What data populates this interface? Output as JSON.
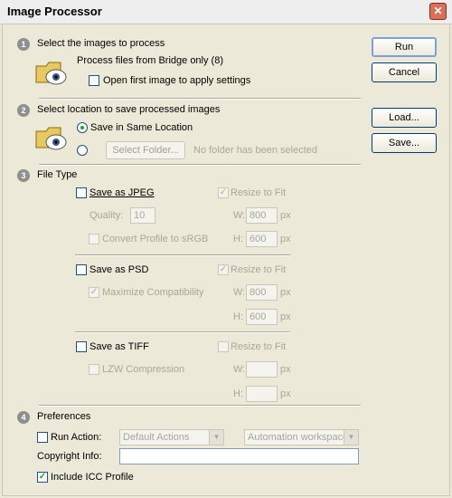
{
  "window": {
    "title": "Image Processor",
    "close_glyph": "✕"
  },
  "buttons": {
    "run": "Run",
    "cancel": "Cancel",
    "load": "Load...",
    "save": "Save..."
  },
  "section1": {
    "number": "1",
    "heading": "Select the images to process",
    "process_text": "Process files from Bridge only (8)",
    "open_first_label": "Open first image to apply settings",
    "open_first_checked": false
  },
  "section2": {
    "number": "2",
    "heading": "Select location to save processed images",
    "same_location_label": "Save in Same Location",
    "select_folder_label": "Select Folder...",
    "no_folder_text": "No folder has been selected",
    "selected_option": "same_location"
  },
  "section3": {
    "number": "3",
    "heading": "File Type",
    "jpeg": {
      "label": "Save as JPEG",
      "checked": false,
      "resize_label": "Resize to Fit",
      "resize_checked": true,
      "quality_label": "Quality:",
      "quality_value": "10",
      "convert_label": "Convert Profile to sRGB",
      "convert_checked": false,
      "w_label": "W:",
      "w_value": "800",
      "w_unit": "px",
      "h_label": "H:",
      "h_value": "600",
      "h_unit": "px"
    },
    "psd": {
      "label": "Save as PSD",
      "checked": false,
      "resize_label": "Resize to Fit",
      "resize_checked": true,
      "maximize_label": "Maximize Compatibility",
      "maximize_checked": true,
      "w_label": "W:",
      "w_value": "800",
      "w_unit": "px",
      "h_label": "H:",
      "h_value": "600",
      "h_unit": "px"
    },
    "tiff": {
      "label": "Save as TIFF",
      "checked": false,
      "resize_label": "Resize to Fit",
      "resize_checked": false,
      "lzw_label": "LZW Compression",
      "lzw_checked": false,
      "w_label": "W:",
      "w_value": "",
      "w_unit": "px",
      "h_label": "H:",
      "h_value": "",
      "h_unit": "px"
    }
  },
  "section4": {
    "number": "4",
    "heading": "Preferences",
    "run_action_label": "Run Action:",
    "run_action_checked": false,
    "action_set": "Default Actions",
    "action_name": "Automation workspaces",
    "copyright_label": "Copyright Info:",
    "copyright_value": "",
    "icc_label": "Include ICC Profile",
    "icc_checked": true
  },
  "icons": {
    "close": "close-icon",
    "folder": "folder-eye-icon",
    "dropdown": "chevron-down-icon",
    "checkmark": "checkmark-icon"
  },
  "colors": {
    "dialog_bg": "#ece9d8",
    "close_red": "#d6705a",
    "check_green": "#21a121"
  }
}
